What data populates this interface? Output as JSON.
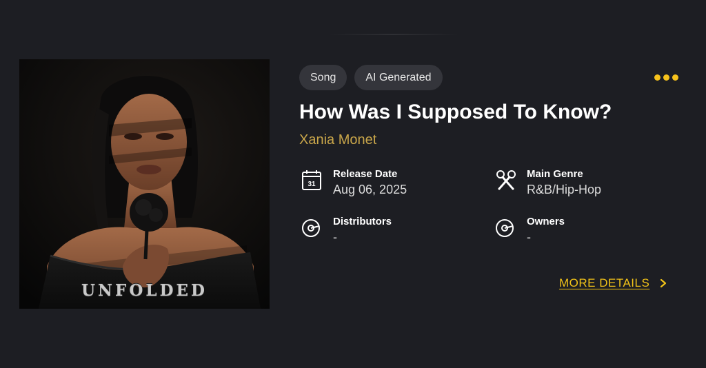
{
  "cover": {
    "overlay_title": "UNFOLDED"
  },
  "tags": [
    "Song",
    "AI Generated"
  ],
  "song": {
    "title": "How Was I Supposed To Know?",
    "artist": "Xania Monet"
  },
  "details": {
    "release_date": {
      "label": "Release Date",
      "value": "Aug 06, 2025",
      "icon": "calendar-icon",
      "icon_day": "31"
    },
    "main_genre": {
      "label": "Main Genre",
      "value": "R&B/Hip-Hop",
      "icon": "microphones-icon"
    },
    "distributors": {
      "label": "Distributors",
      "value": "-",
      "icon": "disc-icon"
    },
    "owners": {
      "label": "Owners",
      "value": "-",
      "icon": "disc-icon"
    }
  },
  "actions": {
    "more_details": "MORE DETAILS",
    "more_menu_icon": "ellipsis-icon"
  },
  "colors": {
    "background": "#1d1e23",
    "accent": "#f2c318",
    "artist": "#c9a64a",
    "tag_bg": "#34353b"
  }
}
